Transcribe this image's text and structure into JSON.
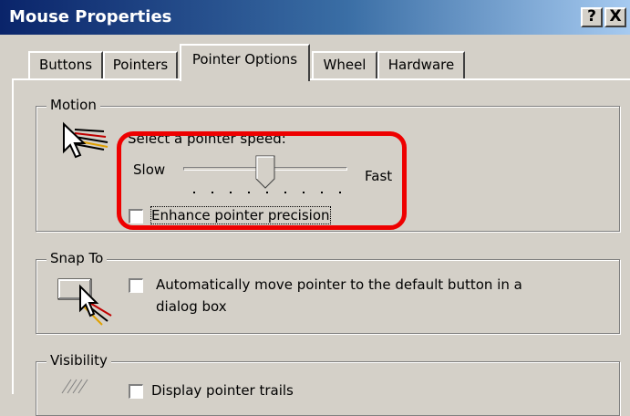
{
  "window": {
    "title": "Mouse Properties",
    "help_button": "?",
    "close_button": "X"
  },
  "tabs": [
    {
      "label": "Buttons",
      "selected": false
    },
    {
      "label": "Pointers",
      "selected": false
    },
    {
      "label": "Pointer Options",
      "selected": true
    },
    {
      "label": "Wheel",
      "selected": false
    },
    {
      "label": "Hardware",
      "selected": false
    }
  ],
  "motion": {
    "legend": "Motion",
    "speed_label": "Select a pointer speed:",
    "slow_label": "Slow",
    "fast_label": "Fast",
    "speed_value_fraction": 0.5,
    "enhance_precision": {
      "label": "Enhance pointer precision",
      "checked": false
    }
  },
  "snap_to": {
    "legend": "Snap To",
    "option": {
      "label_line1": "Automatically move pointer to the default button in a",
      "label_line2": "dialog box",
      "checked": false
    }
  },
  "visibility": {
    "legend": "Visibility",
    "trails": {
      "label": "Display pointer trails",
      "checked": false
    }
  },
  "annotation": {
    "color": "#ee0000"
  },
  "colors": {
    "titlebar": "#0a246a",
    "face": "#d4d0c8"
  }
}
